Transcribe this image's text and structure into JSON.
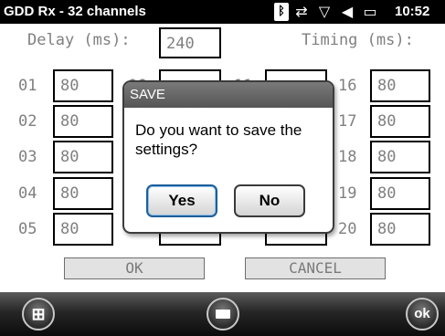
{
  "status_bar": {
    "title": "GDD Rx - 32 channels",
    "time": "10:52",
    "icons": [
      "bluetooth-icon",
      "sync-icon",
      "signal-off-icon",
      "volume-mute-icon",
      "battery-icon"
    ]
  },
  "header": {
    "delay_label": "Delay (ms):",
    "delay_value": "240",
    "timing_label": "Timing (ms):"
  },
  "channels": [
    {
      "id": "01",
      "value": "80"
    },
    {
      "id": "02",
      "value": "80"
    },
    {
      "id": "03",
      "value": "80"
    },
    {
      "id": "04",
      "value": "80"
    },
    {
      "id": "05",
      "value": "80"
    },
    {
      "id": "16",
      "value": "80"
    },
    {
      "id": "17",
      "value": "80"
    },
    {
      "id": "18",
      "value": "80"
    },
    {
      "id": "19",
      "value": "80"
    },
    {
      "id": "20",
      "value": "80"
    }
  ],
  "partially_visible": {
    "channel_06_fragment": "06",
    "channel_11_fragment": "11"
  },
  "buttons": {
    "ok": "OK",
    "cancel": "CANCEL"
  },
  "dialog": {
    "title": "SAVE",
    "message": "Do you want to save the settings?",
    "yes": "Yes",
    "no": "No"
  },
  "bottom_bar": {
    "start_glyph": "⊞",
    "ok_label": "ok"
  }
}
